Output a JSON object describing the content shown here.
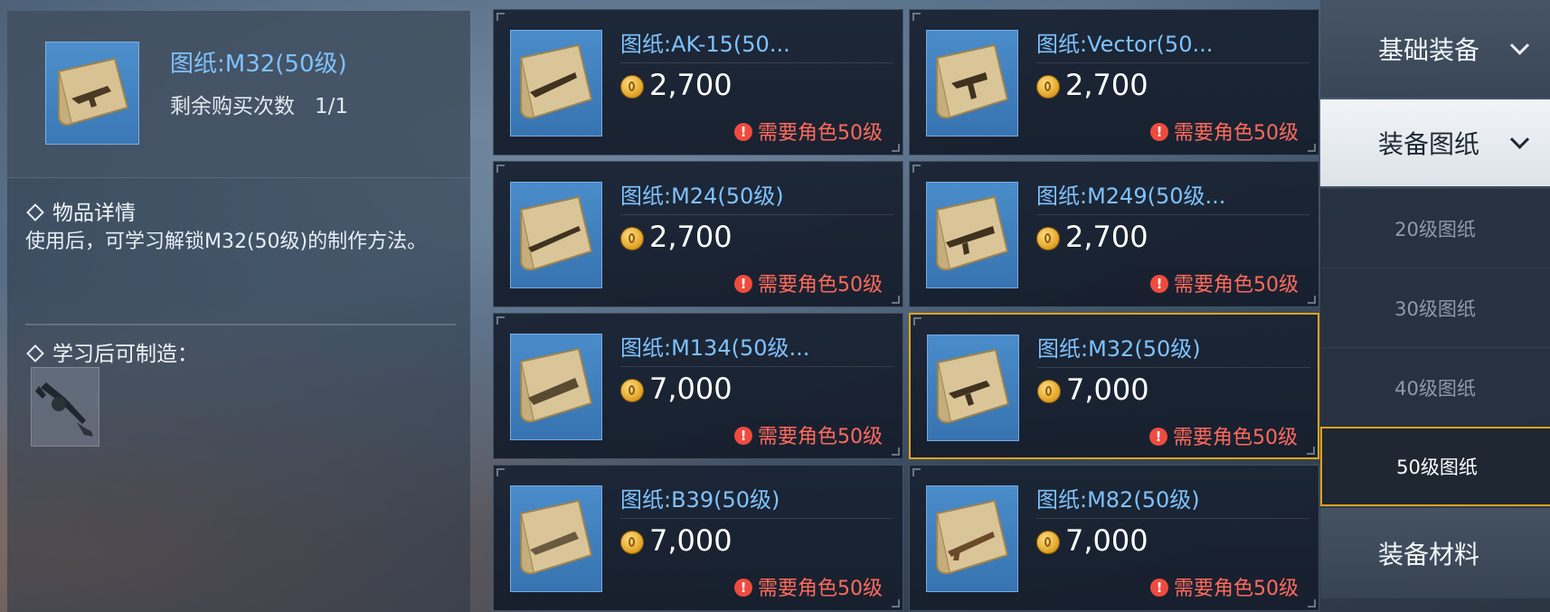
{
  "detail": {
    "title": "图纸:M32(50级)",
    "remaining_label": "剩余购买次数",
    "remaining_value": "1/1",
    "section_detail": "物品详情",
    "description": "使用后，可学习解锁M32(50级)的制作方法。",
    "section_craft": "学习后可制造："
  },
  "items": [
    {
      "name": "图纸:AK-15(50...",
      "price": "2,700",
      "requirement": "需要角色50级"
    },
    {
      "name": "图纸:Vector(50...",
      "price": "2,700",
      "requirement": "需要角色50级"
    },
    {
      "name": "图纸:M24(50级)",
      "price": "2,700",
      "requirement": "需要角色50级"
    },
    {
      "name": "图纸:M249(50级...",
      "price": "2,700",
      "requirement": "需要角色50级"
    },
    {
      "name": "图纸:M134(50级...",
      "price": "7,000",
      "requirement": "需要角色50级"
    },
    {
      "name": "图纸:M32(50级)",
      "price": "7,000",
      "requirement": "需要角色50级"
    },
    {
      "name": "图纸:B39(50级)",
      "price": "7,000",
      "requirement": "需要角色50级"
    },
    {
      "name": "图纸:M82(50级)",
      "price": "7,000",
      "requirement": "需要角色50级"
    }
  ],
  "nav": {
    "basic_equipment": "基础装备",
    "equipment_blueprints": "装备图纸",
    "sub": [
      "20级图纸",
      "30级图纸",
      "40级图纸",
      "50级图纸"
    ],
    "equipment_materials": "装备材料"
  },
  "warn_glyph": "!",
  "colors": {
    "accent": "#e6a21a",
    "title_blue": "#7fc2ff",
    "warning_red": "#ff6a5c"
  }
}
